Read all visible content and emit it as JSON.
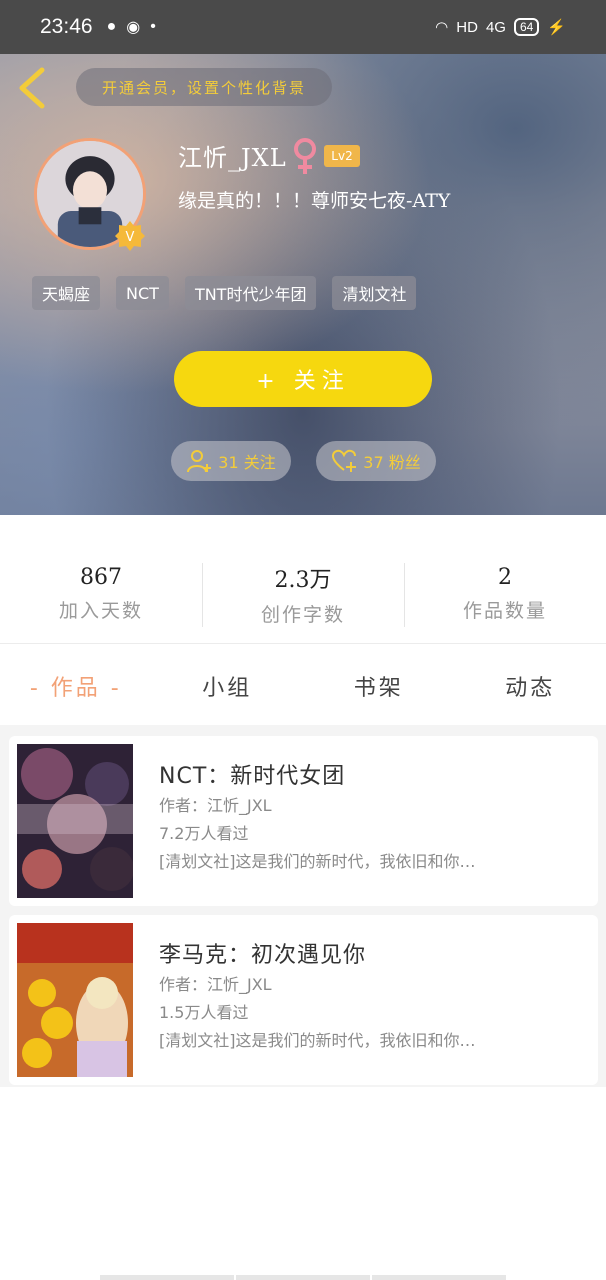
{
  "status_bar": {
    "time": "23:46",
    "network": "HD",
    "signal": "4G",
    "battery": "64"
  },
  "header": {
    "vip_prompt": "开通会员，设置个性化背景",
    "username": "江忻_JXL",
    "level": "Lv2",
    "signature": "缘是真的！！！尊师安七夜-ATY",
    "tags": [
      "天蝎座",
      "NCT",
      "TNT时代少年团",
      "清划文社"
    ],
    "follow_button": "+ 关注",
    "following": "31 关注",
    "fans": "37 粉丝"
  },
  "stats": [
    {
      "value": "867",
      "label": "加入天数"
    },
    {
      "value": "2.3万",
      "label": "创作字数"
    },
    {
      "value": "2",
      "label": "作品数量"
    }
  ],
  "tabs": [
    "- 作品 -",
    "小组",
    "书架",
    "动态"
  ],
  "works": [
    {
      "title": "NCT：新时代女团",
      "author": "作者：江忻_JXL",
      "views": "7.2万人看过",
      "desc": "[清划文社]这是我们的新时代，我依旧和你…"
    },
    {
      "title": "李马克：初次遇见你",
      "author": "作者：江忻_JXL",
      "views": "1.5万人看过",
      "desc": "[清划文社]这是我们的新时代，我依旧和你…"
    }
  ],
  "colors": {
    "accent_yellow": "#f6d80f",
    "accent_orange": "#f2a176",
    "vip_text": "#f3cc3a"
  }
}
